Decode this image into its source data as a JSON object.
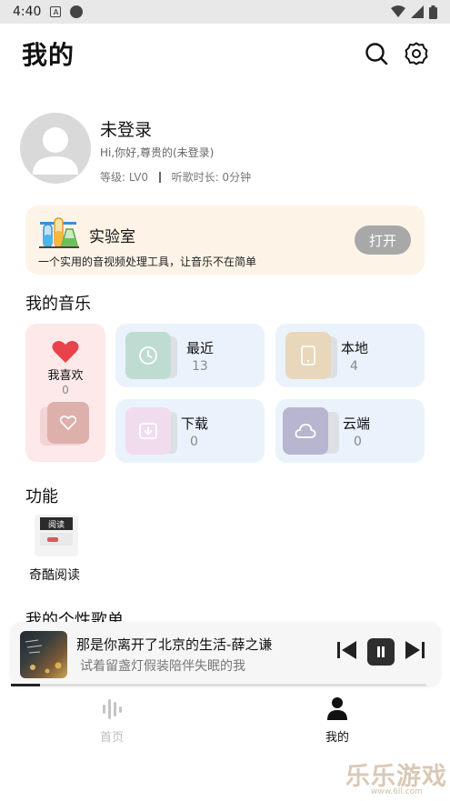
{
  "status_bar": {
    "time": "4:40",
    "notification_letter": "A"
  },
  "header": {
    "title": "我的",
    "icons": [
      "search-icon",
      "gear-icon"
    ]
  },
  "profile": {
    "name": "未登录",
    "greeting": "Hi,你好,尊贵的(未登录)",
    "level": "等级: LV0",
    "listen_time": "听歌时长: 0分钟"
  },
  "lab": {
    "title": "实验室",
    "description": "一个实用的音视频处理工具，让音乐不在简单",
    "open_label": "打开"
  },
  "my_music": {
    "title": "我的音乐",
    "favorites": {
      "label": "我喜欢",
      "count": "0"
    },
    "cards": [
      {
        "label": "最近",
        "count": "13",
        "icon": "clock-icon",
        "color": "#bfdcd2"
      },
      {
        "label": "本地",
        "count": "4",
        "icon": "phone-icon",
        "color": "#e8d7ba"
      },
      {
        "label": "下载",
        "count": "0",
        "icon": "download-icon",
        "color": "#f1dcee"
      },
      {
        "label": "云端",
        "count": "0",
        "icon": "cloud-icon",
        "color": "#b7b5cf"
      }
    ]
  },
  "functions": {
    "title": "功能",
    "items": [
      {
        "label": "奇酷阅读",
        "thumb_text": "阅读"
      }
    ]
  },
  "playlists": {
    "title": "我的个性歌单"
  },
  "player": {
    "song_title": "那是你离开了北京的生活-薛之谦",
    "lyric": "试着留盏灯假装陪伴失眠的我",
    "progress": 0.07
  },
  "tabbar": {
    "tabs": [
      {
        "label": "首页",
        "active": false,
        "icon": "audio-wave-icon"
      },
      {
        "label": "我的",
        "active": true,
        "icon": "person-icon"
      }
    ]
  },
  "watermark": {
    "text": "乐乐游戏",
    "url": "www.6ll.com"
  },
  "colors": {
    "accent_heart": "#e8434a",
    "lab_background": "#fdf4e7",
    "card_background": "#eaf3fc",
    "favorites_background": "#fde9ea"
  }
}
